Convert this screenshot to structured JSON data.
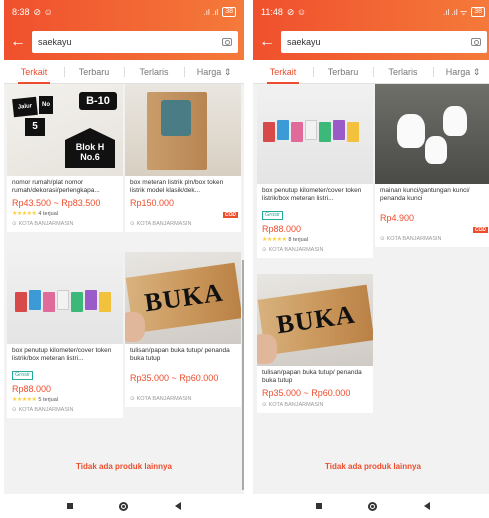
{
  "left": {
    "status": {
      "time": "8:38",
      "battery": "38"
    },
    "search": {
      "query": "saekayu"
    },
    "tabs": [
      "Terkait",
      "Terbaru",
      "Terlaris",
      "Harga"
    ],
    "active_tab": 0,
    "products": [
      {
        "name": "nomor rumah/plat nomor rumah/dekorasi/perlengkapa...",
        "price": "Rp43.500 ~ Rp83.500",
        "rating_stars": "★★★★★",
        "sold": "4 terjual",
        "location": "KOTA BANJARMASIN",
        "image": "house-number-plates"
      },
      {
        "name": "box meteran listrik pln/box token listrik model klasik/dek...",
        "price": "Rp150.000",
        "badge": "COD",
        "location": "KOTA BANJARMASIN",
        "image": "wooden-meter-box"
      },
      {
        "name": "box penutup kilometer/cover token listrik/box meteran listri...",
        "tag": "Grosir",
        "price": "Rp88.000",
        "rating_stars": "★★★★★",
        "sold": "5 terjual",
        "location": "KOTA BANJARMASIN",
        "image": "colorful-meter-boxes"
      },
      {
        "name": "tulisan/papan buka tutup/ penanda buka tutup",
        "price": "Rp35.000 ~ Rp60.000",
        "location": "KOTA BANJARMASIN",
        "image": "buka-sign"
      }
    ],
    "plate_texts": {
      "p1a": "Jalur",
      "p1b": "No",
      "p1c": "5",
      "p1d": "B-10",
      "p1e": "Blok H",
      "p1f": "No.6"
    },
    "buka_text": "BUKA",
    "end_text": "Tidak ada produk lainnya"
  },
  "right": {
    "status": {
      "time": "11:48",
      "battery": "38"
    },
    "search": {
      "query": "saekayu"
    },
    "tabs": [
      "Terkait",
      "Terbaru",
      "Terlaris",
      "Harga"
    ],
    "active_tab": 0,
    "products": [
      {
        "name": "box penutup kilometer/cover token listrik/box meteran listri...",
        "tag": "Grosir",
        "price": "Rp88.000",
        "rating_stars": "★★★★★",
        "sold": "8 terjual",
        "location": "KOTA BANJARMASIN",
        "image": "colorful-meter-boxes"
      },
      {
        "name": "mainan kunci/gantungan kunci/ penanda kunci",
        "price": "Rp4.900",
        "badge": "COD",
        "location": "KOTA BANJARMASIN",
        "image": "tooth-keychain"
      },
      {
        "name": "tulisan/papan buka tutup/ penanda buka tutup",
        "price": "Rp35.000 ~ Rp60.000",
        "location": "KOTA BANJARMASIN",
        "image": "buka-sign"
      }
    ],
    "buka_text": "BUKA",
    "end_text": "Tidak ada produk lainnya"
  },
  "icons": {
    "back": "arrow-left-icon",
    "camera": "camera-icon",
    "location": "location-pin-icon",
    "sort": "sort-icon"
  },
  "colors": {
    "brand": "#ee4d2d",
    "tag": "#26aa99",
    "star": "#ffce3d"
  }
}
